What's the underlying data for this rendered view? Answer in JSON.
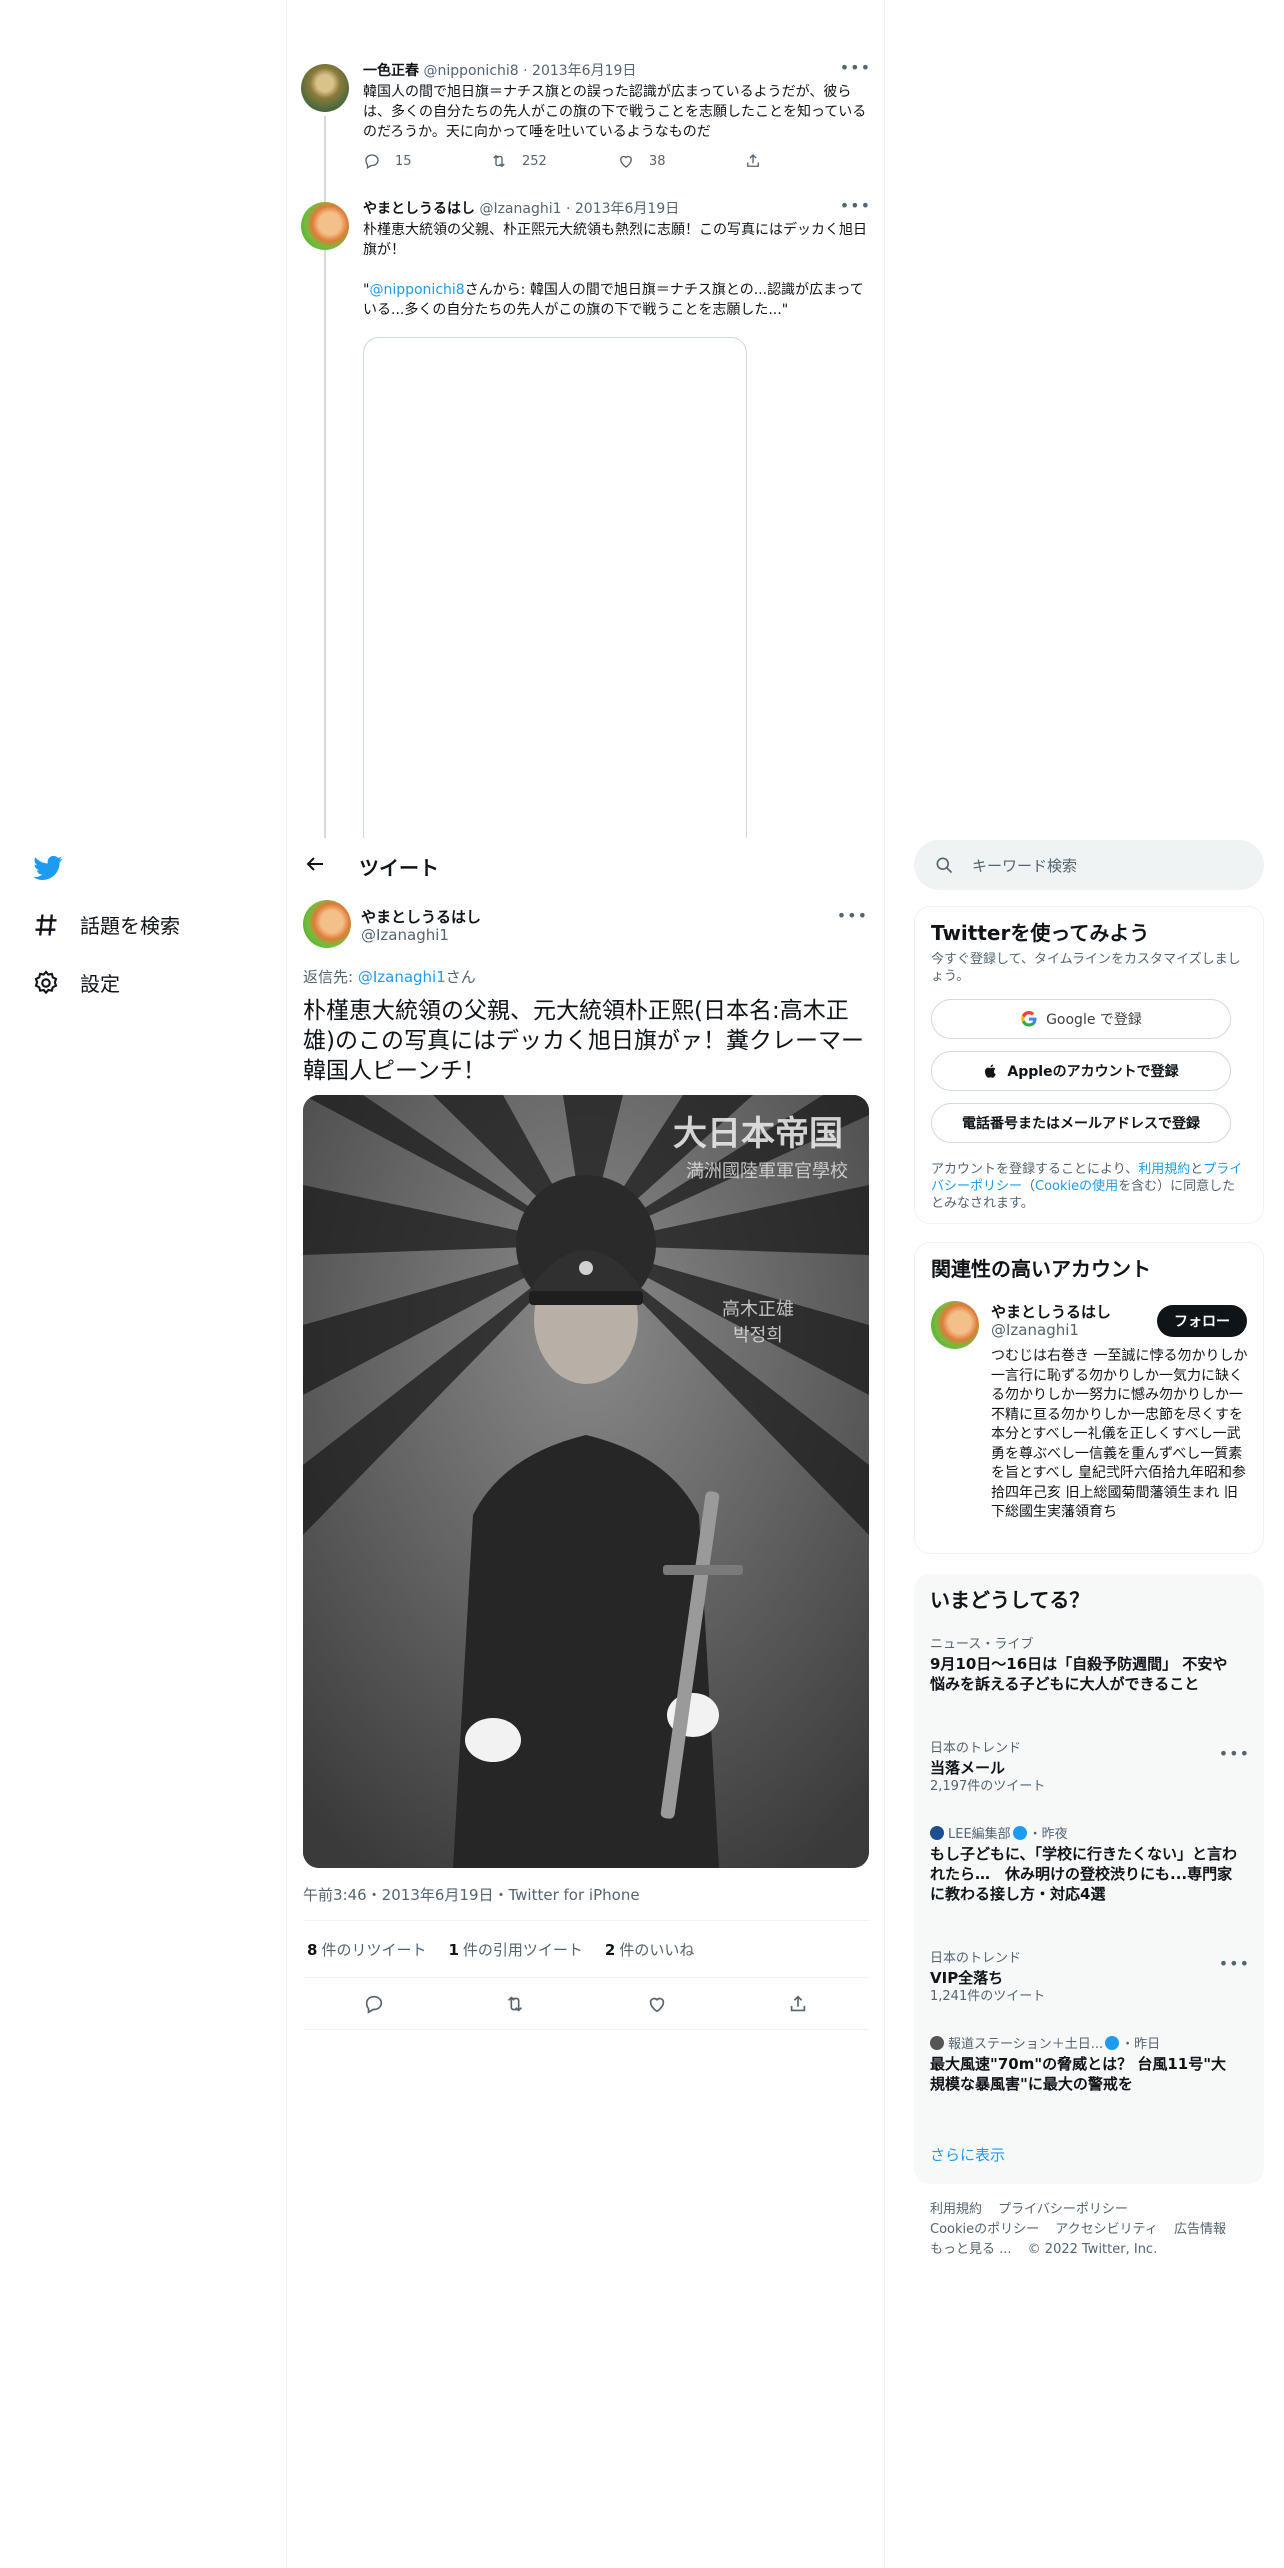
{
  "thread": {
    "t1": {
      "name": "一色正春",
      "handle": "@nipponichi8",
      "date": "2013年6月19日",
      "text": "韓国人の間で旭日旗＝ナチス旗との誤った認識が広まっているようだが、彼らは、多くの自分たちの先人がこの旗の下で戦うことを志願したことを知っているのだろうか。天に向かって唾を吐いているようなものだ",
      "replies": "15",
      "retweets": "252",
      "likes": "38"
    },
    "t2": {
      "name": "やまとしうるはし",
      "handle": "@Izanaghi1",
      "date": "2013年6月19日",
      "text": "朴槿恵大統領の父親、朴正煕元大統領も熱烈に志願！この写真にはデッカく旭日旗が！",
      "quote_open": "\"",
      "quote_link": "@nipponichi8",
      "quote_rest": "さんから: 韓国人の間で旭日旗＝ナチス旗との...認識が広まっている...多くの自分たちの先人がこの旗の下で戦うことを志願した...\""
    }
  },
  "sidebar": {
    "explore": "話題を検索",
    "settings": "設定"
  },
  "header": {
    "title": "ツイート"
  },
  "main": {
    "name": "やまとしうるはし",
    "handle": "@Izanaghi1",
    "reply_prefix": "返信先: ",
    "reply_link": "@Izanaghi1",
    "reply_suffix": "さん",
    "text": "朴槿恵大統領の父親、元大統領朴正熙(日本名:高木正雄)のこの写真にはデッカく旭日旗がァ！糞クレーマー韓国人ピーンチ！",
    "photo_caption_1": "大日本帝国",
    "photo_caption_2": "満洲國陸軍軍官學校",
    "photo_caption_3": "高木正雄",
    "photo_caption_4": "박정희",
    "meta": "午前3:46・2013年6月19日・Twitter for iPhone",
    "retweets_count": "8",
    "retweets_label": "件のリツイート",
    "quotes_count": "1",
    "quotes_label": "件の引用ツイート",
    "likes_count": "2",
    "likes_label": "件のいいね"
  },
  "search": {
    "placeholder": "キーワード検索"
  },
  "signup": {
    "title": "Twitterを使ってみよう",
    "subtitle": "今すぐ登録して、タイムラインをカスタマイズしましょう。",
    "google": "Google で登録",
    "apple": "Appleのアカウントで登録",
    "phone": "電話番号またはメールアドレスで登録",
    "legal_1": "アカウントを登録することにより、",
    "legal_terms": "利用規約",
    "legal_2": "と",
    "legal_privacy": "プライバシーポリシー",
    "legal_3": "（",
    "legal_cookie": "Cookieの使用",
    "legal_4": "を含む）に同意したとみなされます。"
  },
  "related": {
    "title": "関連性の高いアカウント",
    "name": "やまとしうるはし",
    "handle": "@Izanaghi1",
    "follow": "フォロー",
    "bio": "つむじは右巻き 一至誠に悖る勿かりしか一言行に恥ずる勿かりしか一気力に缺くる勿かりしか一努力に憾み勿かりしか一不精に亘る勿かりしか一忠節を尽くすを本分とすべし一礼儀を正しくすべし一武勇を尊ぶべし一信義を重んずべし一質素を旨とすべし 皇紀弐阡六佰拾九年昭和参拾四年己亥 旧上総國菊間藩領生まれ 旧下総國生実藩領育ち"
  },
  "trends": {
    "title": "いまどうしてる？",
    "items": [
      {
        "context": "ニュース・ライブ",
        "title": "9月10日〜16日は「自殺予防週間」 不安や悩みを訴える子どもに大人ができること",
        "count": ""
      },
      {
        "context": "日本のトレンド",
        "title": "当落メール",
        "count": "2,197件のツイート"
      },
      {
        "context": "LEE編集部",
        "context_time": "・昨夜",
        "title": "もし子どもに、「学校に行きたくない」と言われたら…　休み明けの登校渋りにも...専門家に教わる接し方・対応4選",
        "count": ""
      },
      {
        "context": "日本のトレンド",
        "title": "VIP全落ち",
        "count": "1,241件のツイート"
      },
      {
        "context": "報道ステーション＋土日...",
        "context_time": "・昨日",
        "title": "最大風速\"70m\"の脅威とは？ 台風11号\"大規模な暴風害\"に最大の警戒を",
        "count": ""
      }
    ],
    "show_more": "さらに表示"
  },
  "footer": {
    "terms": "利用規約",
    "privacy": "プライバシーポリシー",
    "cookie": "Cookieのポリシー",
    "accessibility": "アクセシビリティ",
    "ads": "広告情報",
    "more": "もっと見る ...",
    "copyright": "© 2022 Twitter, Inc."
  },
  "colors": {
    "accent": "#1d9bf0",
    "text": "#0f1419",
    "muted": "#536471",
    "border": "#eff3f4"
  },
  "icons": [
    "twitter-logo-icon",
    "hashtag-icon",
    "gear-icon",
    "back-arrow-icon",
    "search-icon",
    "reply-icon",
    "retweet-icon",
    "like-icon",
    "share-icon",
    "google-icon",
    "apple-icon",
    "more-icon",
    "verified-icon"
  ]
}
